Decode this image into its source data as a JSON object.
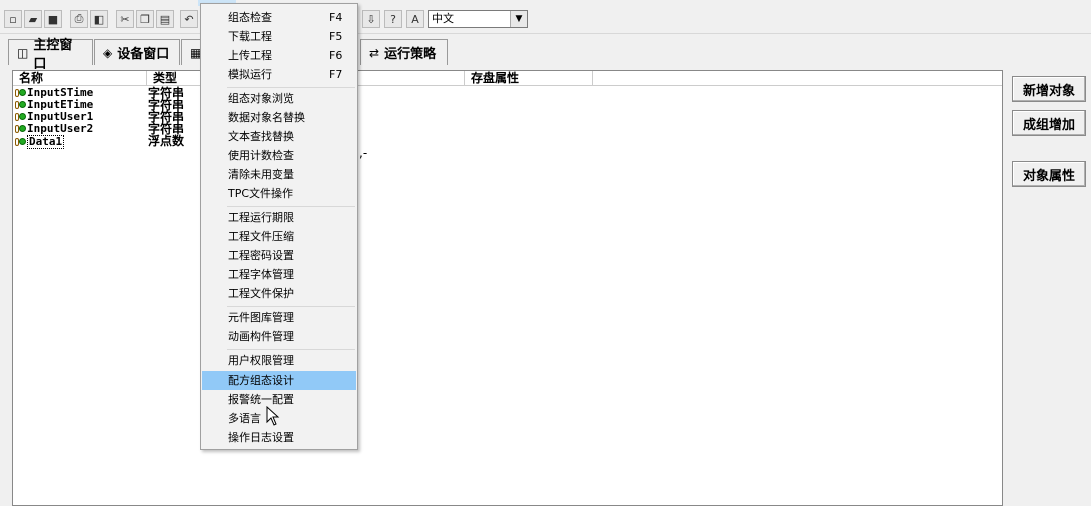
{
  "toolbar": {
    "language": "中文"
  },
  "tabs": [
    {
      "label": "主控窗口",
      "icon": "window-icon"
    },
    {
      "label": "设备窗口",
      "icon": "device-icon"
    },
    {
      "label": "运行策略",
      "icon": "strategy-icon"
    }
  ],
  "list": {
    "headers": [
      "名称",
      "类型",
      "存盘属性"
    ],
    "rows": [
      {
        "name": "InputSTime",
        "type": "字符串"
      },
      {
        "name": "InputETime",
        "type": "字符串"
      },
      {
        "name": "InputUser1",
        "type": "字符串"
      },
      {
        "name": "InputUser2",
        "type": "字符串"
      },
      {
        "name": "Data1",
        "type": "浮点数"
      }
    ],
    "stray_text": ",-"
  },
  "side_buttons": {
    "add": "新增对象",
    "group_add": "成组增加",
    "props": "对象属性"
  },
  "menu": {
    "items": [
      {
        "label": "组态检查",
        "shortcut": "F4"
      },
      {
        "label": "下载工程",
        "shortcut": "F5"
      },
      {
        "label": "上传工程",
        "shortcut": "F6"
      },
      {
        "label": "模拟运行",
        "shortcut": "F7"
      },
      {
        "label": "组态对象浏览",
        "shortcut": ""
      },
      {
        "label": "数据对象名替换",
        "shortcut": ""
      },
      {
        "label": "文本查找替换",
        "shortcut": ""
      },
      {
        "label": "使用计数检查",
        "shortcut": ""
      },
      {
        "label": "清除未用变量",
        "shortcut": ""
      },
      {
        "label": "TPC文件操作",
        "shortcut": ""
      },
      {
        "label": "工程运行期限",
        "shortcut": ""
      },
      {
        "label": "工程文件压缩",
        "shortcut": ""
      },
      {
        "label": "工程密码设置",
        "shortcut": ""
      },
      {
        "label": "工程字体管理",
        "shortcut": ""
      },
      {
        "label": "工程文件保护",
        "shortcut": ""
      },
      {
        "label": "元件图库管理",
        "shortcut": ""
      },
      {
        "label": "动画构件管理",
        "shortcut": ""
      },
      {
        "label": "用户权限管理",
        "shortcut": ""
      },
      {
        "label": "配方组态设计",
        "shortcut": ""
      },
      {
        "label": "报警统一配置",
        "shortcut": ""
      },
      {
        "label": "多语言",
        "shortcut": ""
      },
      {
        "label": "操作日志设置",
        "shortcut": ""
      }
    ]
  }
}
